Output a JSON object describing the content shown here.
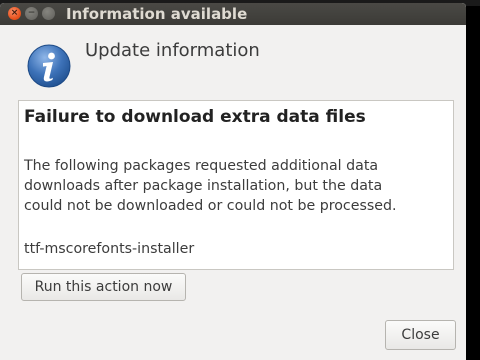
{
  "window": {
    "title": "Information available",
    "controls": {
      "close_icon": "close-icon",
      "minimize_icon": "minimize-icon",
      "maximize_icon": "maximize-icon"
    }
  },
  "header": {
    "icon": "info-icon",
    "heading": "Update information"
  },
  "content": {
    "title": "Failure to download extra data files",
    "body_lines": [
      "The following packages requested additional data",
      "downloads after package installation, but the data",
      "could not be downloaded or could not be processed."
    ],
    "package": "ttf-mscorefonts-installer"
  },
  "actions": {
    "run_label": "Run this action now",
    "close_label": "Close"
  },
  "colors": {
    "titlebar": "#3c3b37",
    "close_button": "#e95420",
    "window_bg": "#f2f1f0",
    "info_icon": "#3d72b8"
  }
}
